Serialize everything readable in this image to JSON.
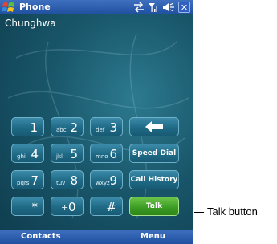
{
  "title_bar": {
    "app_title": "Phone",
    "icons": [
      "windows-start-icon",
      "connectivity-icon",
      "signal-icon",
      "volume-icon",
      "close-icon"
    ],
    "close_label": "✕"
  },
  "operator_name": "Chunghwa",
  "keypad": {
    "keys": [
      {
        "num": "1",
        "sub": ""
      },
      {
        "num": "2",
        "sub": "abc"
      },
      {
        "num": "3",
        "sub": "def"
      },
      {
        "num": "4",
        "sub": "ghi"
      },
      {
        "num": "5",
        "sub": "jkl"
      },
      {
        "num": "6",
        "sub": "mno"
      },
      {
        "num": "7",
        "sub": "pqrs"
      },
      {
        "num": "8",
        "sub": "tuv"
      },
      {
        "num": "9",
        "sub": "wxyz"
      },
      {
        "num": "*",
        "sub": ""
      },
      {
        "num": "0",
        "sub": "+"
      },
      {
        "num": "#",
        "sub": ""
      }
    ],
    "speed_dial_label": "Speed Dial",
    "call_history_label": "Call History",
    "talk_label": "Talk"
  },
  "soft_keys": {
    "left": "Contacts",
    "right": "Menu"
  },
  "annotation": {
    "label": "Talk button"
  },
  "colors": {
    "title_bar": "#1f4f9f",
    "keypad_key": "#1f6a86",
    "talk_button": "#3a9a22",
    "background": "#19566a"
  }
}
